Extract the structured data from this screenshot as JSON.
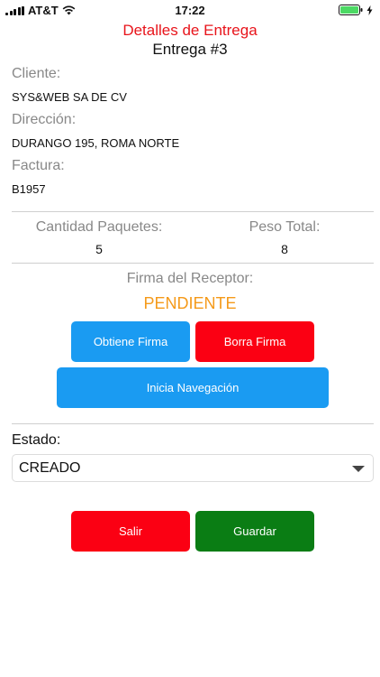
{
  "status_bar": {
    "carrier": "AT&T",
    "time": "17:22"
  },
  "header": {
    "title": "Detalles de Entrega",
    "subtitle": "Entrega #3",
    "title_color": "#e8141b"
  },
  "details": {
    "client_label": "Cliente:",
    "client_value": "SYS&WEB SA DE CV",
    "address_label": "Dirección:",
    "address_value": "DURANGO 195, ROMA NORTE",
    "invoice_label": "Factura:",
    "invoice_value": "B1957"
  },
  "summary": {
    "packages_label": "Cantidad Paquetes:",
    "packages_value": "5",
    "weight_label": "Peso Total:",
    "weight_value": "8"
  },
  "signature": {
    "label": "Firma del Receptor:",
    "status": "PENDIENTE",
    "status_color": "#f59a1a"
  },
  "actions": {
    "get_signature": "Obtiene Firma",
    "clear_signature": "Borra Firma",
    "start_navigation": "Inicia Navegación"
  },
  "state": {
    "label": "Estado:",
    "selected": "CREADO"
  },
  "footer": {
    "exit": "Salir",
    "save": "Guardar"
  },
  "colors": {
    "blue": "#1a9bf2",
    "red": "#fb0013",
    "green": "#0a7d14",
    "battery": "#4cd964"
  },
  "icons": [
    "signal-icon",
    "wifi-icon",
    "battery-icon",
    "charging-icon",
    "chevron-down-icon"
  ]
}
